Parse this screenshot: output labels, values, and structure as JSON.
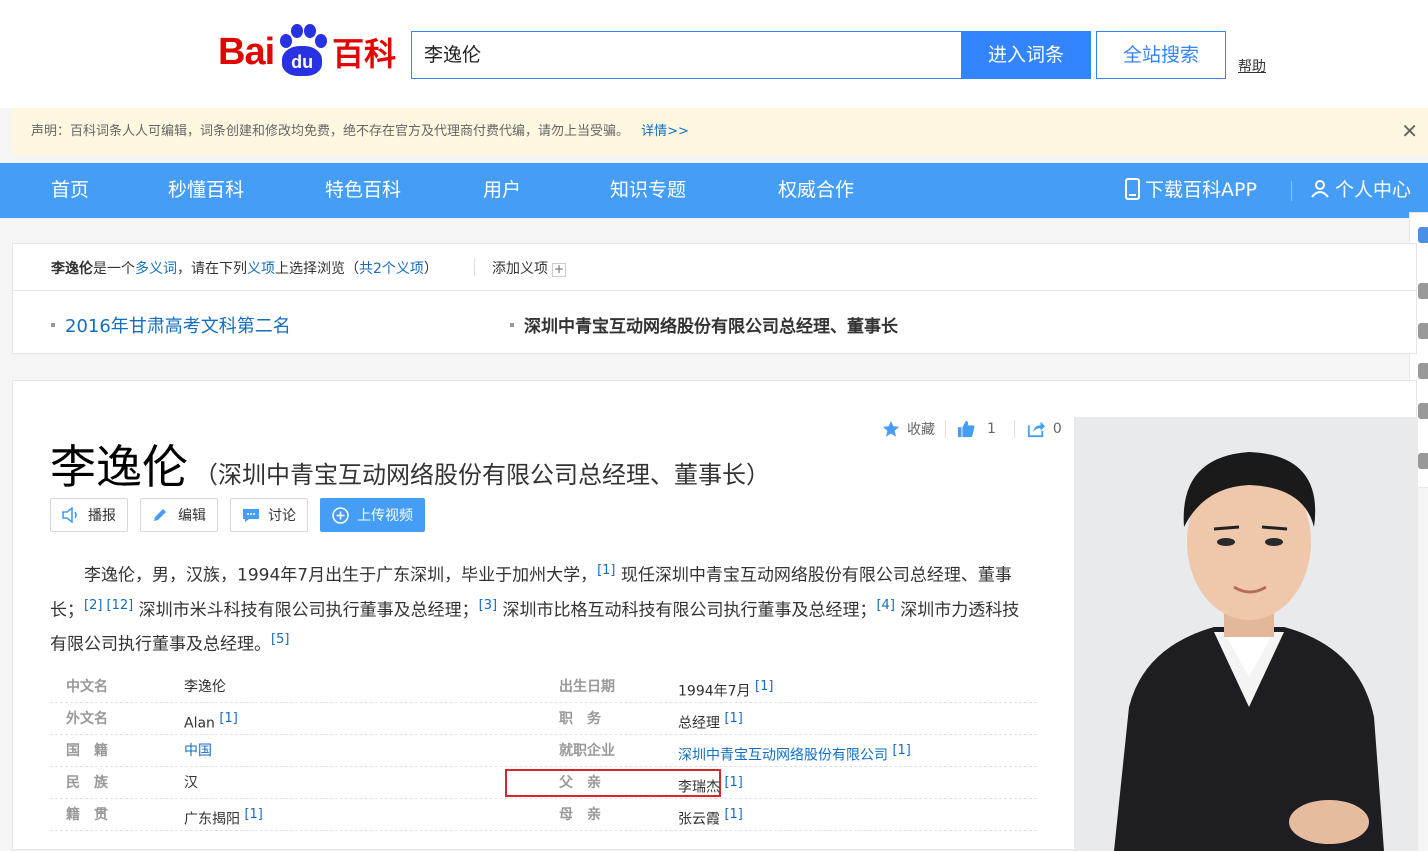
{
  "header": {
    "logo_text": "Baidu百科",
    "logo_bai": "Bai",
    "logo_du": "du",
    "logo_baike": "百科",
    "search_value": "李逸伦",
    "enter_button": "进入词条",
    "site_search_button": "全站搜索",
    "help_link": "帮助"
  },
  "notice": {
    "text": "声明：百科词条人人可编辑，词条创建和修改均免费，绝不存在官方及代理商付费代编，请勿上当受骗。",
    "more": "详情>>",
    "close_icon": "close-icon"
  },
  "nav": {
    "items": [
      "首页",
      "秒懂百科",
      "特色百科",
      "用户",
      "知识专题",
      "权威合作"
    ],
    "download_app": "下载百科APP",
    "personal_center": "个人中心"
  },
  "polysemy": {
    "name": "李逸伦",
    "is_a": "是一个",
    "polysemous_word": "多义词",
    "mid_text": "，请在下列",
    "meaning_item": "义项",
    "tail_text": "上选择浏览（",
    "count_text": "共2个义项",
    "close_paren": "）",
    "add_meaning": "添加义项",
    "plus": "+",
    "options": [
      "2016年甘肃高考文科第二名",
      "深圳中青宝互动网络股份有限公司总经理、董事长"
    ]
  },
  "entry": {
    "title": "李逸伦",
    "subtitle": "（深圳中青宝互动网络股份有限公司总经理、董事长）",
    "collect": "收藏",
    "like_count": "1",
    "share_count": "0",
    "buttons": [
      "播报",
      "编辑",
      "讨论",
      "上传视频"
    ],
    "summary_parts": [
      "李逸伦，男，汉族，1994年7月出生于广东深圳，毕业于加州大学，",
      "[1]",
      " 现任深圳中青宝互动网络股份有限公司总经理、董事长；",
      "[2]",
      " [12]",
      " 深圳市米斗科技有限公司执行董事及总经理；",
      "[3]",
      " 深圳市比格互动科技有限公司执行董事及总经理；",
      "[4]",
      " 深圳市力透科技有限公司执行董事及总经理。",
      "[5]"
    ]
  },
  "basic_info": {
    "left": [
      {
        "label": "中文名",
        "value": "李逸伦",
        "ref": ""
      },
      {
        "label": "外文名",
        "value": "Alan",
        "ref": "[1]"
      },
      {
        "label": "国　籍",
        "value": "中国",
        "ref": ""
      },
      {
        "label": "民　族",
        "value": "汉",
        "ref": ""
      },
      {
        "label": "籍　贯",
        "value": "广东揭阳",
        "ref": "[1]"
      }
    ],
    "right": [
      {
        "label": "出生日期",
        "value": "1994年7月",
        "ref": "[1]"
      },
      {
        "label": "职　务",
        "value": "总经理",
        "ref": "[1]"
      },
      {
        "label": "就职企业",
        "value": "深圳中青宝互动网络股份有限公司",
        "ref": "[1]"
      },
      {
        "label": "父　亲",
        "value": "李瑞杰",
        "ref": "[1]"
      },
      {
        "label": "母　亲",
        "value": "张云霞",
        "ref": "[1]"
      }
    ]
  },
  "colors": {
    "brand_blue": "#459df5",
    "link": "#136ec2",
    "highlight_border": "#d9262c",
    "notice_bg": "#fef7e0"
  }
}
